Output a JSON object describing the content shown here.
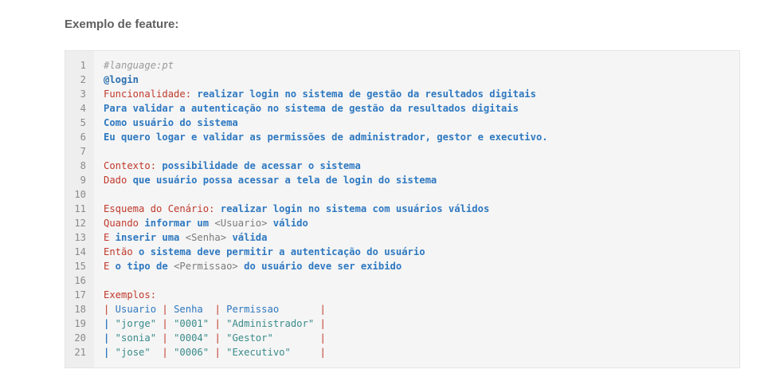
{
  "heading": "Exemplo de feature:",
  "lines": [
    {
      "n": "1",
      "segments": [
        {
          "t": "#language:pt",
          "c": "c-comment"
        }
      ]
    },
    {
      "n": "2",
      "segments": [
        {
          "t": "@login",
          "c": "c-tag"
        }
      ]
    },
    {
      "n": "3",
      "segments": [
        {
          "t": "Funcionalidade:",
          "c": "c-kw"
        },
        {
          "t": " realizar login no sistema de gestão da resultados digitais",
          "c": "c-txt"
        }
      ]
    },
    {
      "n": "4",
      "segments": [
        {
          "t": "Para validar a autenticação no sistema de gestão da resultados digitais",
          "c": "c-txt"
        }
      ]
    },
    {
      "n": "5",
      "segments": [
        {
          "t": "Como usuário do sistema",
          "c": "c-txt"
        }
      ]
    },
    {
      "n": "6",
      "segments": [
        {
          "t": "Eu quero logar e validar as permissões de administrador, gestor e executivo.",
          "c": "c-txt"
        }
      ]
    },
    {
      "n": "7",
      "segments": []
    },
    {
      "n": "8",
      "segments": [
        {
          "t": "Contexto:",
          "c": "c-kw"
        },
        {
          "t": " possibilidade de acessar o sistema",
          "c": "c-txt"
        }
      ]
    },
    {
      "n": "9",
      "segments": [
        {
          "t": "Dado",
          "c": "c-kw"
        },
        {
          "t": " que usuário possa acessar a tela de login do sistema",
          "c": "c-txt"
        }
      ]
    },
    {
      "n": "10",
      "segments": []
    },
    {
      "n": "11",
      "segments": [
        {
          "t": "Esquema do Cenário:",
          "c": "c-kw"
        },
        {
          "t": " realizar login no sistema com usuários válidos",
          "c": "c-txt"
        }
      ]
    },
    {
      "n": "12",
      "segments": [
        {
          "t": "Quando",
          "c": "c-kw"
        },
        {
          "t": " informar um ",
          "c": "c-txt"
        },
        {
          "t": "<Usuario>",
          "c": "c-ph"
        },
        {
          "t": " válido",
          "c": "c-txt"
        }
      ]
    },
    {
      "n": "13",
      "segments": [
        {
          "t": "E",
          "c": "c-kw"
        },
        {
          "t": " inserir uma ",
          "c": "c-txt"
        },
        {
          "t": "<Senha>",
          "c": "c-ph"
        },
        {
          "t": " válida",
          "c": "c-txt"
        }
      ]
    },
    {
      "n": "14",
      "segments": [
        {
          "t": "Então",
          "c": "c-kw"
        },
        {
          "t": " o sistema deve permitir a autenticação do usuário",
          "c": "c-txt"
        }
      ]
    },
    {
      "n": "15",
      "segments": [
        {
          "t": "E",
          "c": "c-kw"
        },
        {
          "t": " o tipo de ",
          "c": "c-txt"
        },
        {
          "t": "<Permissao>",
          "c": "c-ph"
        },
        {
          "t": " do usuário deve ser exibido",
          "c": "c-txt"
        }
      ]
    },
    {
      "n": "16",
      "segments": []
    },
    {
      "n": "17",
      "segments": [
        {
          "t": "Exemplos:",
          "c": "c-kw"
        }
      ]
    },
    {
      "n": "18",
      "segments": [
        {
          "t": "|",
          "c": "c-pipe"
        },
        {
          "t": " Usuario ",
          "c": "c-hdr"
        },
        {
          "t": "|",
          "c": "c-pipe"
        },
        {
          "t": " Senha  ",
          "c": "c-hdr"
        },
        {
          "t": "|",
          "c": "c-pipe"
        },
        {
          "t": " Permissao       ",
          "c": "c-hdr"
        },
        {
          "t": "|",
          "c": "c-pipe"
        }
      ]
    },
    {
      "n": "19",
      "segments": [
        {
          "t": "|",
          "c": "c-pipe-b"
        },
        {
          "t": " \"jorge\" ",
          "c": "c-str"
        },
        {
          "t": "|",
          "c": "c-pipe"
        },
        {
          "t": " \"0001\" ",
          "c": "c-str"
        },
        {
          "t": "|",
          "c": "c-pipe"
        },
        {
          "t": " \"Administrador\" ",
          "c": "c-str"
        },
        {
          "t": "|",
          "c": "c-pipe"
        }
      ]
    },
    {
      "n": "20",
      "segments": [
        {
          "t": "|",
          "c": "c-pipe-b"
        },
        {
          "t": " \"sonia\" ",
          "c": "c-str"
        },
        {
          "t": "|",
          "c": "c-pipe"
        },
        {
          "t": " \"0004\" ",
          "c": "c-str"
        },
        {
          "t": "|",
          "c": "c-pipe"
        },
        {
          "t": " \"Gestor\"        ",
          "c": "c-str"
        },
        {
          "t": "|",
          "c": "c-pipe"
        }
      ]
    },
    {
      "n": "21",
      "segments": [
        {
          "t": "|",
          "c": "c-pipe-b"
        },
        {
          "t": " \"jose\"  ",
          "c": "c-str"
        },
        {
          "t": "|",
          "c": "c-pipe"
        },
        {
          "t": " \"0006\" ",
          "c": "c-str"
        },
        {
          "t": "|",
          "c": "c-pipe"
        },
        {
          "t": " \"Executivo\"     ",
          "c": "c-str"
        },
        {
          "t": "|",
          "c": "c-pipe"
        }
      ]
    }
  ]
}
